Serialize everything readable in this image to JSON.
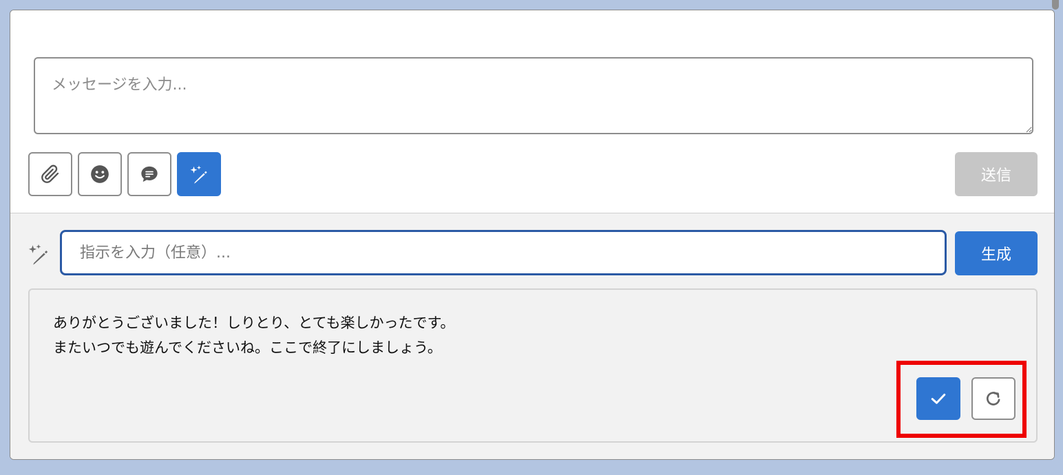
{
  "composer": {
    "message_placeholder": "メッセージを入力...",
    "toolbar": {
      "attach_icon": "paperclip-icon",
      "emoji_icon": "smiley-icon",
      "quick_reply_icon": "chat-bubble-icon",
      "ai_assist_icon": "magic-pen-icon"
    },
    "send_label": "送信"
  },
  "assistant": {
    "icon": "magic-pen-icon",
    "instruction_placeholder": "指示を入力（任意）...",
    "generate_label": "生成",
    "suggestion": {
      "lines": [
        "ありがとうございました！しりとり、とても楽しかったです。",
        "またいつでも遊んでくださいね。ここで終了にしましょう。"
      ],
      "accept_icon": "checkmark-icon",
      "regenerate_icon": "refresh-icon"
    }
  },
  "colors": {
    "accent": "#2f76d2",
    "disabled": "#c6c6c6",
    "highlight": "#ee0000",
    "background": "#b3c5e1"
  }
}
